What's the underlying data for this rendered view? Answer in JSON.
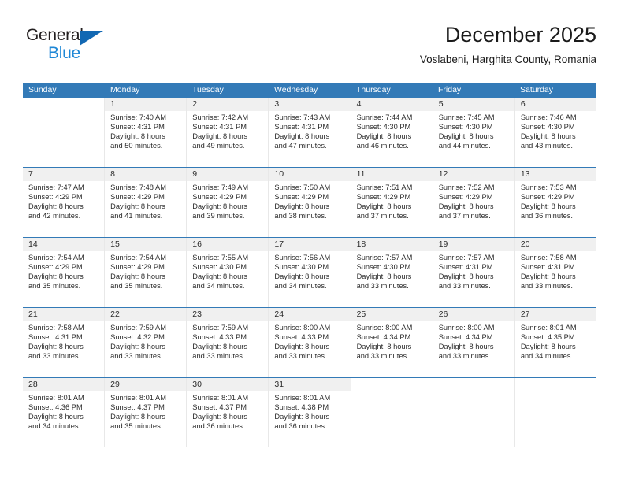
{
  "brand": {
    "name_part1": "General",
    "name_part2": "Blue",
    "accent_color": "#1268b3",
    "blue_text_color": "#1e87d6"
  },
  "header": {
    "title": "December 2025",
    "subtitle": "Voslabeni, Harghita County, Romania"
  },
  "calendar": {
    "header_bg": "#337ab7",
    "weekdays": [
      "Sunday",
      "Monday",
      "Tuesday",
      "Wednesday",
      "Thursday",
      "Friday",
      "Saturday"
    ],
    "weeks": [
      [
        {
          "date": "",
          "lines": []
        },
        {
          "date": "1",
          "lines": [
            "Sunrise: 7:40 AM",
            "Sunset: 4:31 PM",
            "Daylight: 8 hours",
            "and 50 minutes."
          ]
        },
        {
          "date": "2",
          "lines": [
            "Sunrise: 7:42 AM",
            "Sunset: 4:31 PM",
            "Daylight: 8 hours",
            "and 49 minutes."
          ]
        },
        {
          "date": "3",
          "lines": [
            "Sunrise: 7:43 AM",
            "Sunset: 4:31 PM",
            "Daylight: 8 hours",
            "and 47 minutes."
          ]
        },
        {
          "date": "4",
          "lines": [
            "Sunrise: 7:44 AM",
            "Sunset: 4:30 PM",
            "Daylight: 8 hours",
            "and 46 minutes."
          ]
        },
        {
          "date": "5",
          "lines": [
            "Sunrise: 7:45 AM",
            "Sunset: 4:30 PM",
            "Daylight: 8 hours",
            "and 44 minutes."
          ]
        },
        {
          "date": "6",
          "lines": [
            "Sunrise: 7:46 AM",
            "Sunset: 4:30 PM",
            "Daylight: 8 hours",
            "and 43 minutes."
          ]
        }
      ],
      [
        {
          "date": "7",
          "lines": [
            "Sunrise: 7:47 AM",
            "Sunset: 4:29 PM",
            "Daylight: 8 hours",
            "and 42 minutes."
          ]
        },
        {
          "date": "8",
          "lines": [
            "Sunrise: 7:48 AM",
            "Sunset: 4:29 PM",
            "Daylight: 8 hours",
            "and 41 minutes."
          ]
        },
        {
          "date": "9",
          "lines": [
            "Sunrise: 7:49 AM",
            "Sunset: 4:29 PM",
            "Daylight: 8 hours",
            "and 39 minutes."
          ]
        },
        {
          "date": "10",
          "lines": [
            "Sunrise: 7:50 AM",
            "Sunset: 4:29 PM",
            "Daylight: 8 hours",
            "and 38 minutes."
          ]
        },
        {
          "date": "11",
          "lines": [
            "Sunrise: 7:51 AM",
            "Sunset: 4:29 PM",
            "Daylight: 8 hours",
            "and 37 minutes."
          ]
        },
        {
          "date": "12",
          "lines": [
            "Sunrise: 7:52 AM",
            "Sunset: 4:29 PM",
            "Daylight: 8 hours",
            "and 37 minutes."
          ]
        },
        {
          "date": "13",
          "lines": [
            "Sunrise: 7:53 AM",
            "Sunset: 4:29 PM",
            "Daylight: 8 hours",
            "and 36 minutes."
          ]
        }
      ],
      [
        {
          "date": "14",
          "lines": [
            "Sunrise: 7:54 AM",
            "Sunset: 4:29 PM",
            "Daylight: 8 hours",
            "and 35 minutes."
          ]
        },
        {
          "date": "15",
          "lines": [
            "Sunrise: 7:54 AM",
            "Sunset: 4:29 PM",
            "Daylight: 8 hours",
            "and 35 minutes."
          ]
        },
        {
          "date": "16",
          "lines": [
            "Sunrise: 7:55 AM",
            "Sunset: 4:30 PM",
            "Daylight: 8 hours",
            "and 34 minutes."
          ]
        },
        {
          "date": "17",
          "lines": [
            "Sunrise: 7:56 AM",
            "Sunset: 4:30 PM",
            "Daylight: 8 hours",
            "and 34 minutes."
          ]
        },
        {
          "date": "18",
          "lines": [
            "Sunrise: 7:57 AM",
            "Sunset: 4:30 PM",
            "Daylight: 8 hours",
            "and 33 minutes."
          ]
        },
        {
          "date": "19",
          "lines": [
            "Sunrise: 7:57 AM",
            "Sunset: 4:31 PM",
            "Daylight: 8 hours",
            "and 33 minutes."
          ]
        },
        {
          "date": "20",
          "lines": [
            "Sunrise: 7:58 AM",
            "Sunset: 4:31 PM",
            "Daylight: 8 hours",
            "and 33 minutes."
          ]
        }
      ],
      [
        {
          "date": "21",
          "lines": [
            "Sunrise: 7:58 AM",
            "Sunset: 4:31 PM",
            "Daylight: 8 hours",
            "and 33 minutes."
          ]
        },
        {
          "date": "22",
          "lines": [
            "Sunrise: 7:59 AM",
            "Sunset: 4:32 PM",
            "Daylight: 8 hours",
            "and 33 minutes."
          ]
        },
        {
          "date": "23",
          "lines": [
            "Sunrise: 7:59 AM",
            "Sunset: 4:33 PM",
            "Daylight: 8 hours",
            "and 33 minutes."
          ]
        },
        {
          "date": "24",
          "lines": [
            "Sunrise: 8:00 AM",
            "Sunset: 4:33 PM",
            "Daylight: 8 hours",
            "and 33 minutes."
          ]
        },
        {
          "date": "25",
          "lines": [
            "Sunrise: 8:00 AM",
            "Sunset: 4:34 PM",
            "Daylight: 8 hours",
            "and 33 minutes."
          ]
        },
        {
          "date": "26",
          "lines": [
            "Sunrise: 8:00 AM",
            "Sunset: 4:34 PM",
            "Daylight: 8 hours",
            "and 33 minutes."
          ]
        },
        {
          "date": "27",
          "lines": [
            "Sunrise: 8:01 AM",
            "Sunset: 4:35 PM",
            "Daylight: 8 hours",
            "and 34 minutes."
          ]
        }
      ],
      [
        {
          "date": "28",
          "lines": [
            "Sunrise: 8:01 AM",
            "Sunset: 4:36 PM",
            "Daylight: 8 hours",
            "and 34 minutes."
          ]
        },
        {
          "date": "29",
          "lines": [
            "Sunrise: 8:01 AM",
            "Sunset: 4:37 PM",
            "Daylight: 8 hours",
            "and 35 minutes."
          ]
        },
        {
          "date": "30",
          "lines": [
            "Sunrise: 8:01 AM",
            "Sunset: 4:37 PM",
            "Daylight: 8 hours",
            "and 36 minutes."
          ]
        },
        {
          "date": "31",
          "lines": [
            "Sunrise: 8:01 AM",
            "Sunset: 4:38 PM",
            "Daylight: 8 hours",
            "and 36 minutes."
          ]
        },
        {
          "date": "",
          "lines": []
        },
        {
          "date": "",
          "lines": []
        },
        {
          "date": "",
          "lines": []
        }
      ]
    ]
  }
}
